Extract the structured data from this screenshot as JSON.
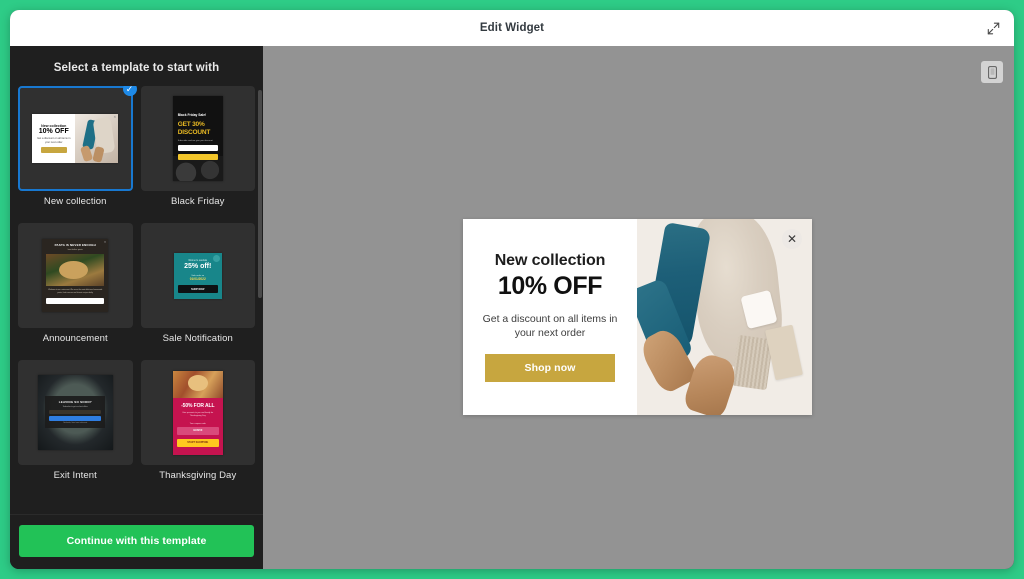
{
  "window": {
    "title": "Edit Widget",
    "expand_icon": "expand-arrows-icon"
  },
  "sidebar": {
    "heading": "Select a template to start with",
    "continue_button": "Continue with this template",
    "templates": [
      {
        "label": "New collection",
        "selected": true,
        "check_glyph": "✓",
        "preview": {
          "title": "New collection",
          "offer": "10% OFF",
          "subtitle": "Get a discount on all items in your next order",
          "cta": "Shop now"
        }
      },
      {
        "label": "Black Friday",
        "selected": false,
        "preview": {
          "heading": "Black Friday Sale!",
          "offer": "GET 30% DISCOUNT",
          "subtitle": "Subscribe and we give you discount",
          "field_placeholder": "E-mail",
          "cta": "GET DISCOUNT"
        }
      },
      {
        "label": "Announcement",
        "selected": false,
        "preview": {
          "title": "PASTA IS NEVER ENOUGH",
          "subtitle": "best italian pasta",
          "body": "Welcome to our restaurant. We serve the most delicious homemade pasta, fresh sauces and classic recipes daily.",
          "cta": "LEARN MORE"
        }
      },
      {
        "label": "Sale Notification",
        "selected": false,
        "preview": {
          "heading": "Women's sandals",
          "offer": "25% off!",
          "note": "Sale ends on",
          "code": "01/01/2022",
          "cta": "SHOP NOW"
        }
      },
      {
        "label": "Exit Intent",
        "selected": false,
        "preview": {
          "heading": "LEAVING SO SOON?",
          "subtitle": "Subscribe to get our best offers",
          "field_placeholder": "E-mail",
          "cta": "SUBSCRIBE",
          "footnote": "No thanks, I don't want a discount"
        }
      },
      {
        "label": "Thanksgiving Day",
        "selected": false,
        "preview": {
          "offer": "-50% FOR ALL",
          "subtitle": "Give presents to you and family for Thanksgiving Day",
          "code_label": "Your coupon code",
          "code": "GIVE50",
          "cta": "START SHOPPING"
        }
      }
    ]
  },
  "canvas": {
    "device_toggle_icon": "mobile-device-icon",
    "popup": {
      "title": "New collection",
      "offer": "10% OFF",
      "subtitle": "Get a discount on all items in your next order",
      "cta": "Shop now",
      "close_glyph": "✕",
      "image_alt": "flat-lay of jeans, knit sweater, mug and suede ankle boots"
    }
  },
  "colors": {
    "background_green": "#2ecc87",
    "continue_green": "#22c257",
    "cta_gold": "#c7a63f",
    "selection_blue": "#1878d0",
    "canvas_gray": "#939393",
    "sidebar_dark": "#1f1f1f"
  }
}
